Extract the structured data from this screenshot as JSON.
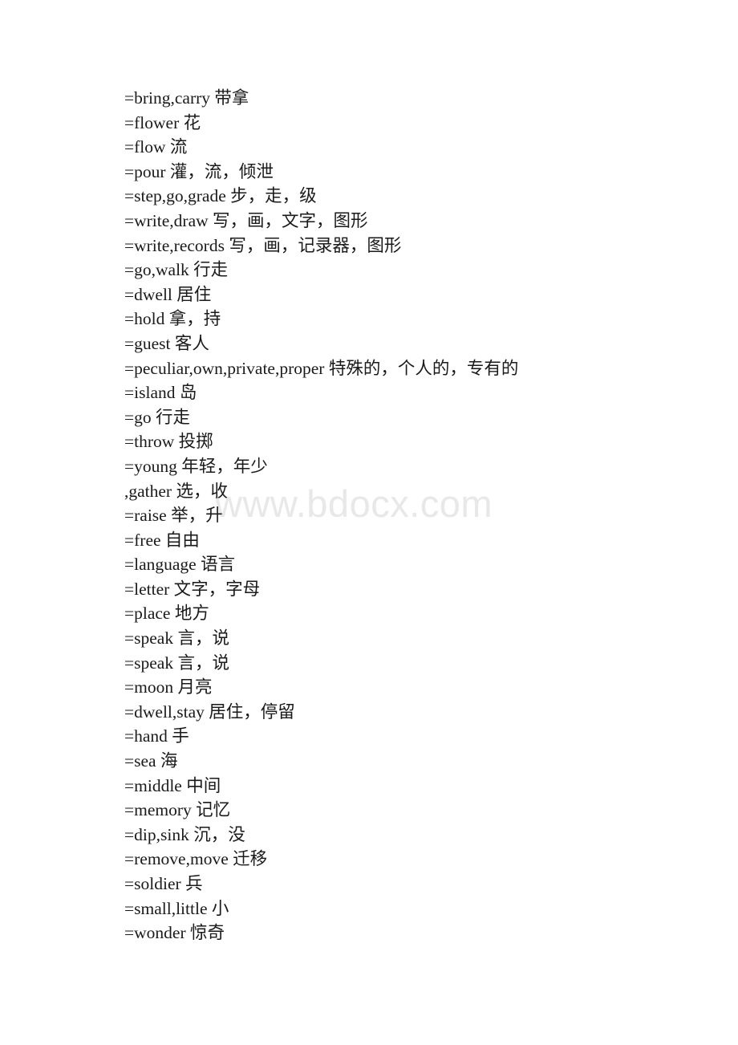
{
  "document": {
    "background_color": "#ffffff",
    "text_color": "#1a1a1a",
    "watermark": {
      "text": "www.bdocx.com",
      "color": "#e8e8e8"
    },
    "lines": [
      "=bring,carry 带拿",
      "=flower 花",
      "=flow 流",
      "=pour 灌，流，倾泄",
      "=step,go,grade 步，走，级",
      "=write,draw 写，画，文字，图形",
      "=write,records 写，画，记录器，图形",
      "=go,walk 行走",
      "=dwell 居住",
      "=hold 拿，持",
      "=guest 客人",
      "=peculiar,own,private,proper 特殊的，个人的，专有的",
      "=island 岛",
      "=go 行走",
      "=throw 投掷",
      "=young 年轻，年少",
      ",gather 选，收",
      "=raise 举，升",
      "=free 自由",
      "=language 语言",
      "=letter 文字，字母",
      "=place 地方",
      "=speak 言，说",
      "=speak 言，说",
      "=moon 月亮",
      "=dwell,stay 居住，停留",
      "=hand 手",
      "=sea 海",
      "=middle 中间",
      "=memory 记忆",
      "=dip,sink 沉，没",
      "=remove,move 迁移",
      "=soldier 兵",
      "=small,little 小",
      "=wonder 惊奇"
    ]
  }
}
